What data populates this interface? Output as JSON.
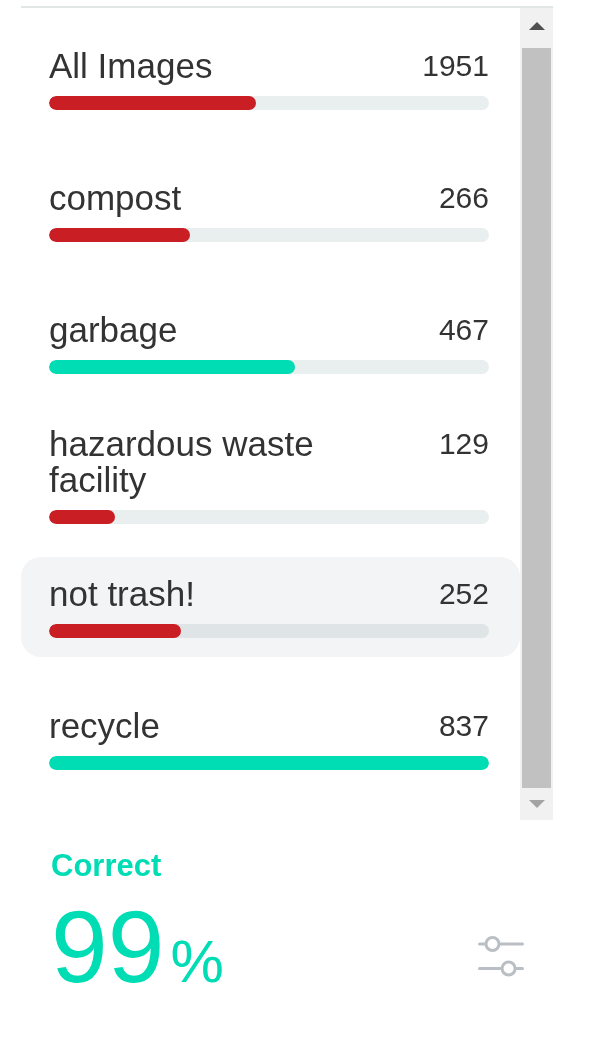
{
  "categories": [
    {
      "label": "All Images",
      "count": "1951",
      "level": 0.47,
      "color": "#c91f24",
      "selected": false
    },
    {
      "label": "compost",
      "count": "266",
      "level": 0.32,
      "color": "#c91f24",
      "selected": false
    },
    {
      "label": "garbage",
      "count": "467",
      "level": 0.56,
      "color": "#00dcb4",
      "selected": false
    },
    {
      "label": "hazardous waste facility",
      "count": "129",
      "level": 0.15,
      "color": "#c91f24",
      "selected": false
    },
    {
      "label": "not trash!",
      "count": "252",
      "level": 0.3,
      "color": "#c91f24",
      "selected": true
    },
    {
      "label": "recycle",
      "count": "837",
      "level": 1,
      "color": "#00dcb4",
      "selected": false
    }
  ],
  "accuracy": {
    "label": "Correct",
    "value": "99",
    "unit": "%"
  }
}
